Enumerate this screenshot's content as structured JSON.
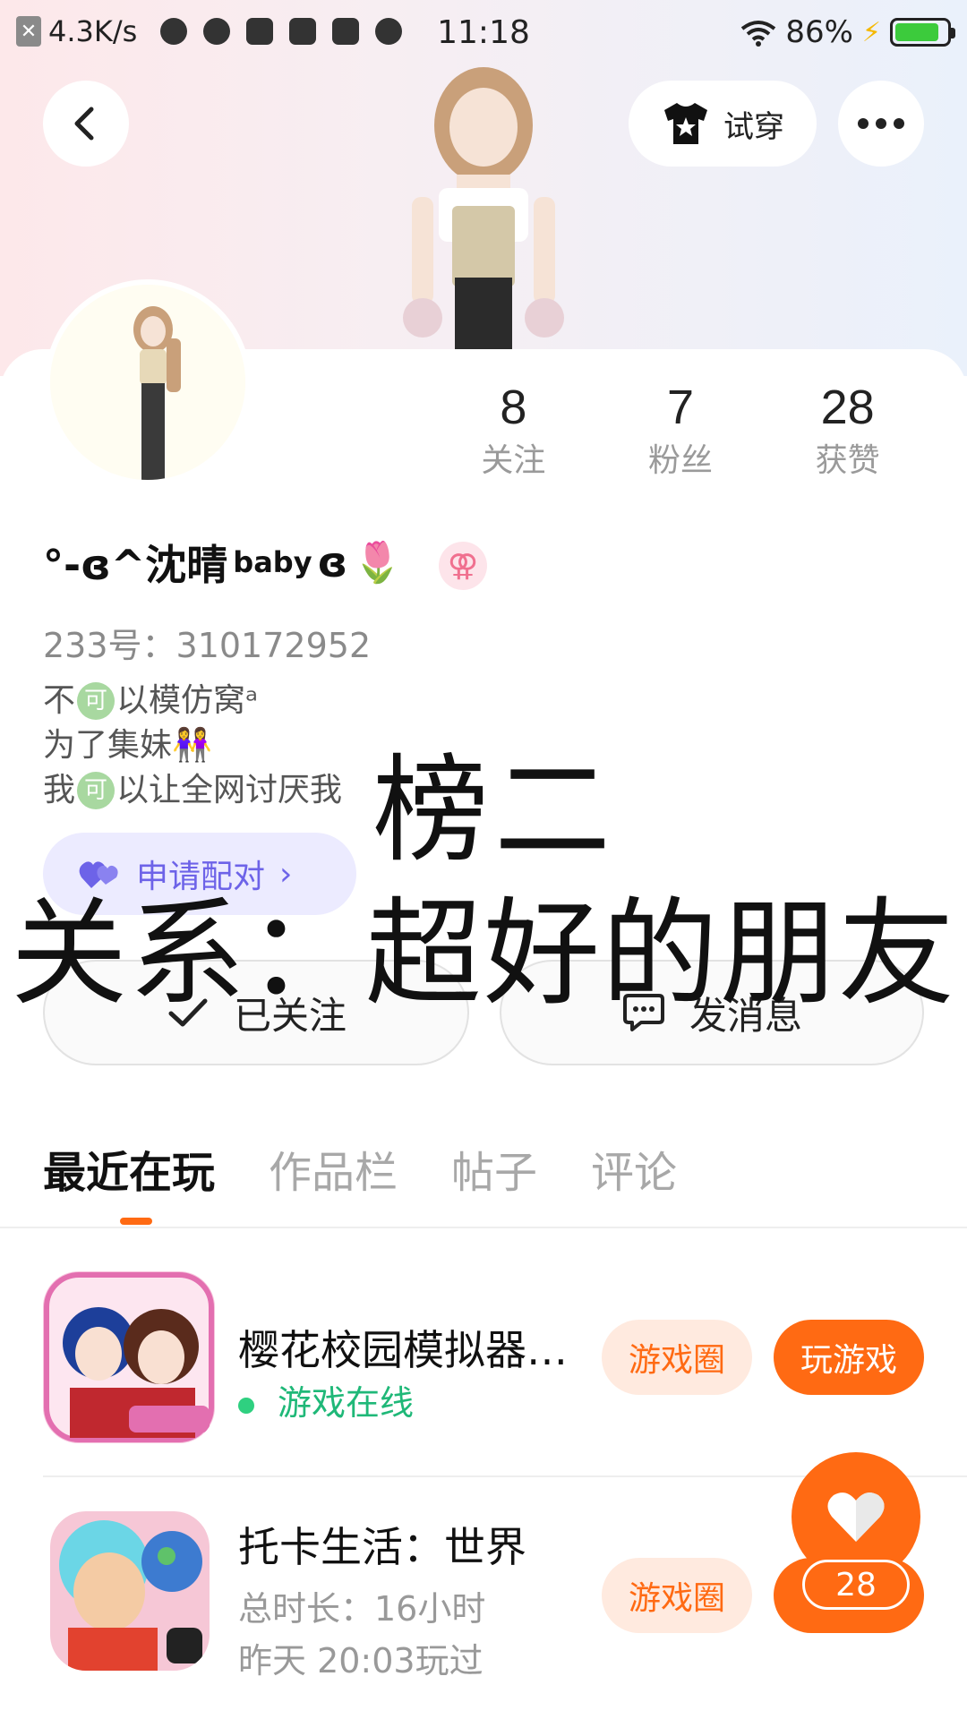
{
  "status_bar": {
    "speed": "4.3K/s",
    "time": "11:18",
    "battery": "86%",
    "battery_level": 0.86
  },
  "header": {
    "tryon_label": "试穿"
  },
  "profile": {
    "stats": [
      {
        "value": "8",
        "label": "关注"
      },
      {
        "value": "7",
        "label": "粉丝"
      },
      {
        "value": "28",
        "label": "获赞"
      }
    ],
    "nickname_prefix": "°-ɞ^沈晴",
    "nickname_sup": "baby",
    "nickname_suffix": "ɞ",
    "gender_symbol": "⚢",
    "uid": "233号：310172952",
    "bio": {
      "line1_a": "不",
      "line1_b": "以模仿窝ᵃ",
      "line2": "为了集妹👭",
      "line3_a": "我",
      "line3_b": "以让全网讨厌我",
      "ke": "可"
    },
    "pair_label": "申请配对",
    "follow_label": "已关注",
    "message_label": "发消息"
  },
  "overlay": {
    "rank": "榜二",
    "relation": "关系：超好的朋友"
  },
  "tabs": [
    "最近在玩",
    "作品栏",
    "帖子",
    "评论"
  ],
  "games": [
    {
      "title": "樱花校园模拟器…",
      "status": "游戏在线",
      "circle_label": "游戏圈",
      "play_label": "玩游戏"
    },
    {
      "title": "托卡生活：世界",
      "duration": "总时长：16小时",
      "last_played": "昨天 20:03玩过",
      "circle_label": "游戏圈"
    }
  ],
  "like": {
    "count": "28"
  },
  "colors": {
    "accent": "#ff6a13",
    "pair": "#6d63e8",
    "online": "#1fb878"
  }
}
